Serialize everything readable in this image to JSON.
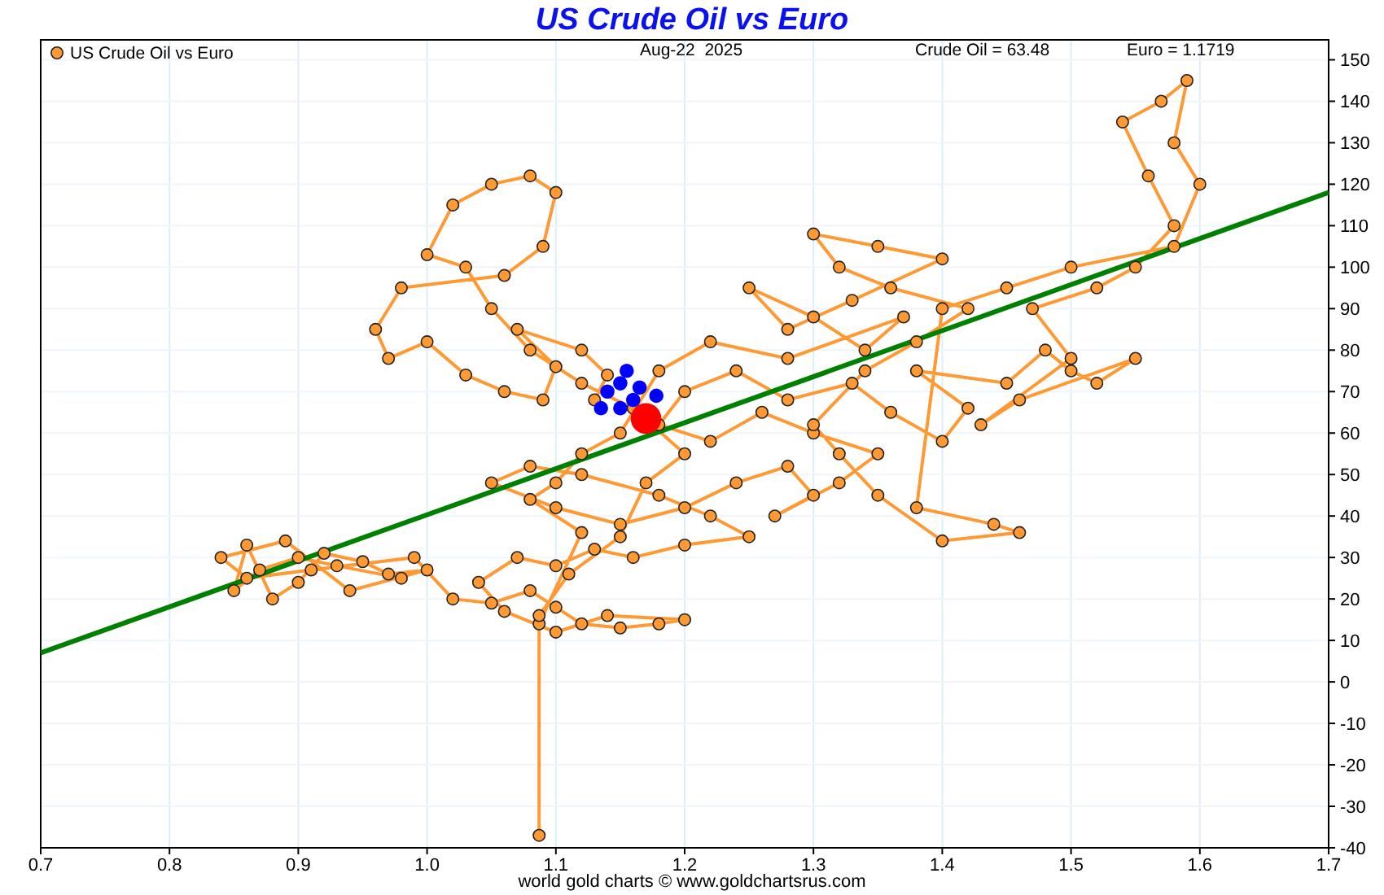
{
  "chart": {
    "chart_data": {
      "type": "scatter",
      "title": "US Crude Oil vs Euro",
      "xlim": [
        0.7,
        1.7
      ],
      "ylim": [
        -40,
        155
      ],
      "xticks": [
        0.7,
        0.8,
        0.9,
        {
          "value": 1,
          "label": "1.0"
        },
        1.1,
        1.2,
        1.3,
        1.4,
        1.5,
        1.6,
        1.7
      ],
      "yticks": [
        -40,
        -30,
        -20,
        -10,
        0,
        10,
        20,
        30,
        40,
        50,
        60,
        70,
        80,
        90,
        100,
        110,
        120,
        130,
        140,
        150
      ],
      "series": [
        {
          "name": "US Crude Oil vs Euro",
          "color": "#ff9933",
          "type": "line",
          "marker": true,
          "x": [
            0.98,
            0.93,
            0.9,
            0.87,
            0.85,
            0.86,
            0.88,
            0.9,
            0.92,
            0.95,
            0.97,
            1.0,
            0.94,
            0.89,
            0.84,
            0.86,
            0.91,
            0.99,
            1.02,
            1.05,
            1.08,
            1.1,
            1.12,
            1.15,
            1.18,
            1.2,
            1.14,
            1.1,
            1.06,
            1.04,
            1.07,
            1.1,
            1.13,
            1.16,
            1.2,
            1.25,
            1.22,
            1.18,
            1.12,
            1.08,
            1.05,
            1.1,
            1.15,
            1.2,
            1.24,
            1.28,
            1.3,
            1.27,
            1.32,
            1.35,
            1.3,
            1.26,
            1.22,
            1.18,
            1.2,
            1.24,
            1.28,
            1.33,
            1.36,
            1.4,
            1.42,
            1.38,
            1.45,
            1.48,
            1.5,
            1.52,
            1.55,
            1.46,
            1.43,
            1.5,
            1.47,
            1.52,
            1.55,
            1.58,
            1.56,
            1.54,
            1.57,
            1.59,
            1.58,
            1.6,
            1.58,
            1.5,
            1.45,
            1.4,
            1.38,
            1.44,
            1.46,
            1.4,
            1.35,
            1.32,
            1.3,
            1.34,
            1.38,
            1.42,
            1.36,
            1.32,
            1.3,
            1.35,
            1.4,
            1.33,
            1.28,
            1.25,
            1.3,
            1.34,
            1.37,
            1.28,
            1.22,
            1.18,
            1.15,
            1.12,
            1.1,
            1.08,
            1.12,
            1.087,
            1.087,
            1.087,
            1.11,
            1.15,
            1.17,
            1.2,
            1.16,
            1.12,
            1.08,
            1.05,
            1.03,
            1.0,
            1.02,
            1.05,
            1.08,
            1.1,
            1.09,
            1.06,
            0.98,
            0.96,
            0.97,
            1.0,
            1.03,
            1.06,
            1.09,
            1.1,
            1.07,
            1.12,
            1.14,
            1.13
          ],
          "values": [
            25,
            28,
            30,
            27,
            22,
            33,
            20,
            24,
            31,
            29,
            26,
            27,
            22,
            34,
            30,
            25,
            27,
            30,
            20,
            19,
            22,
            18,
            14,
            13,
            14,
            15,
            16,
            12,
            17,
            24,
            30,
            28,
            32,
            30,
            33,
            35,
            40,
            45,
            50,
            52,
            48,
            42,
            38,
            42,
            48,
            52,
            45,
            40,
            48,
            55,
            60,
            65,
            58,
            62,
            70,
            75,
            68,
            72,
            65,
            58,
            66,
            75,
            72,
            80,
            75,
            72,
            78,
            68,
            62,
            78,
            90,
            95,
            100,
            110,
            122,
            135,
            140,
            145,
            130,
            120,
            105,
            100,
            95,
            90,
            42,
            38,
            36,
            34,
            45,
            55,
            62,
            75,
            82,
            90,
            95,
            100,
            108,
            105,
            102,
            92,
            85,
            95,
            88,
            80,
            88,
            78,
            82,
            75,
            60,
            55,
            48,
            44,
            36,
            14,
            -37,
            16,
            26,
            35,
            48,
            55,
            66,
            72,
            80,
            90,
            100,
            103,
            115,
            120,
            122,
            118,
            105,
            98,
            95,
            85,
            78,
            82,
            74,
            70,
            68,
            76,
            85,
            80,
            74,
            68
          ]
        },
        {
          "color": "#0000ff",
          "x": [
            1.14,
            1.15,
            1.155,
            1.135,
            1.15,
            1.16,
            1.178,
            1.165
          ],
          "values": [
            70,
            72,
            75,
            66,
            66,
            68,
            69,
            71
          ]
        },
        {
          "color": "#ff0000",
          "x": [
            1.17
          ],
          "values": [
            63.5
          ]
        },
        {
          "color": "#008000",
          "type": "line",
          "x": [
            0.7,
            1.7
          ],
          "values": [
            7,
            118
          ]
        }
      ],
      "grid": true
    },
    "date": "Aug-22  2025",
    "readouts": [
      "Crude Oil = 63.48",
      "Euro = 1.1719"
    ]
  },
  "credit": "world gold charts © www.goldchartsrus.com"
}
